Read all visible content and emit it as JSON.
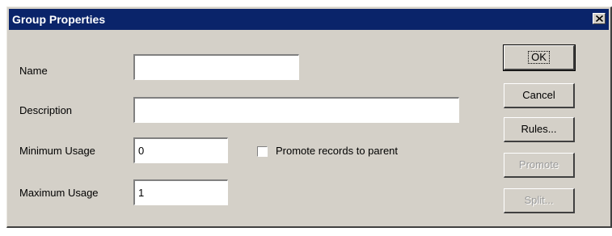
{
  "dialog": {
    "title": "Group Properties",
    "close_icon": "close-icon"
  },
  "fields": {
    "name_label": "Name",
    "name_value": "",
    "description_label": "Description",
    "description_value": "",
    "min_usage_label": "Minimum Usage",
    "min_usage_value": "0",
    "max_usage_label": "Maximum Usage",
    "max_usage_value": "1"
  },
  "options": {
    "promote_label": "Promote records to parent",
    "promote_checked": false
  },
  "buttons": {
    "ok": "OK",
    "cancel": "Cancel",
    "rules": "Rules...",
    "promote": "Promote",
    "split": "Split..."
  },
  "colors": {
    "titlebar": "#0a246a",
    "face": "#d4d0c8"
  }
}
